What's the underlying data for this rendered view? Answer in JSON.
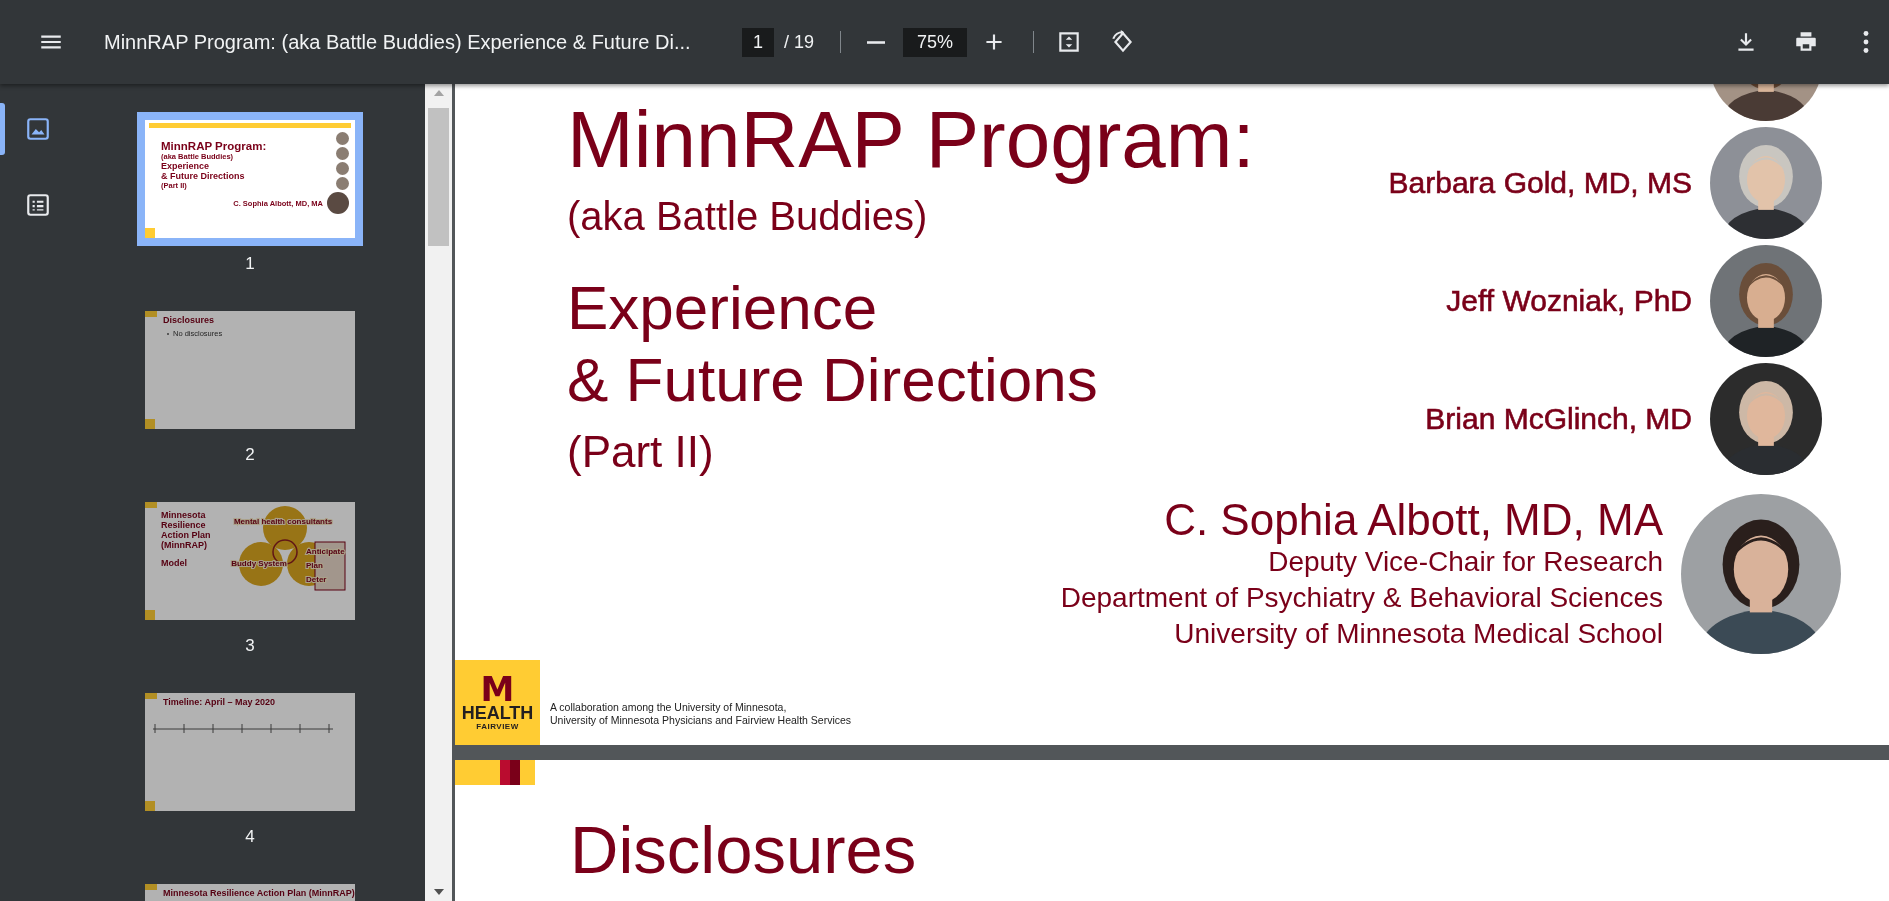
{
  "toolbar": {
    "title": "MinnRAP Program: (aka Battle Buddies) Experience & Future Di...",
    "page_number": "1",
    "page_count": "/ 19",
    "zoom": "75%"
  },
  "sidebar": {
    "views": [
      {
        "kind": "thumbnails",
        "selected": true
      },
      {
        "kind": "outline",
        "selected": false
      }
    ],
    "thumbnails": [
      {
        "kind": "title",
        "page_label": "1",
        "selected": true,
        "lines": [
          "MinnRAP Program:",
          "(aka Battle Buddies)",
          "Experience",
          "& Future Directions",
          "(Part II)",
          "C. Sophia Albott, MD, MA"
        ]
      },
      {
        "kind": "bullets",
        "page_label": "2",
        "selected": false,
        "lines": [
          "Disclosures",
          "No disclosures"
        ]
      },
      {
        "kind": "diagram",
        "page_label": "3",
        "selected": false,
        "lines": [
          "Minnesota Resilience Action Plan (MinnRAP)",
          "Model"
        ],
        "diagram_labels": [
          "Mental health consultants",
          "Buddy System",
          "Anticipate",
          "Plan",
          "Deter"
        ]
      },
      {
        "kind": "timeline",
        "page_label": "4",
        "selected": false,
        "lines": [
          "Timeline: April – May 2020"
        ]
      },
      {
        "kind": "heading",
        "selected": false,
        "lines": [
          "Minnesota Resilience Action Plan (MinnRAP)"
        ]
      }
    ]
  },
  "pages": [
    {
      "kind": "title-slide",
      "title": "MinnRAP Program:",
      "subtitle": "(aka Battle Buddies)",
      "heading_lines": [
        "Experience",
        "& Future Directions"
      ],
      "part": "(Part II)",
      "speakers": [
        {
          "kind": "photo-only",
          "photo": {
            "kind": "picture"
          }
        },
        {
          "kind": "named",
          "name": "Barbara Gold, MD, MS",
          "photo": {
            "kind": "picture"
          }
        },
        {
          "kind": "named",
          "name": "Jeff Wozniak, PhD",
          "photo": {
            "kind": "picture"
          }
        },
        {
          "kind": "named",
          "name": "Brian McGlinch, MD",
          "photo": {
            "kind": "picture"
          }
        }
      ],
      "presenter": {
        "name": "C. Sophia Albott, MD, MA",
        "roles": [
          "Deputy Vice-Chair for Research",
          "Department of Psychiatry & Behavioral Sciences",
          "University of Minnesota Medical School"
        ],
        "photo": {
          "kind": "picture"
        }
      },
      "logo": {
        "mark": "M",
        "line1": "HEALTH",
        "line2": "FAIRVIEW"
      },
      "footer_lines": [
        "A collaboration among the University of Minnesota,",
        "University of Minnesota Physicians and Fairview Health Services"
      ]
    },
    {
      "kind": "heading-slide",
      "heading": "Disclosures"
    }
  ]
}
